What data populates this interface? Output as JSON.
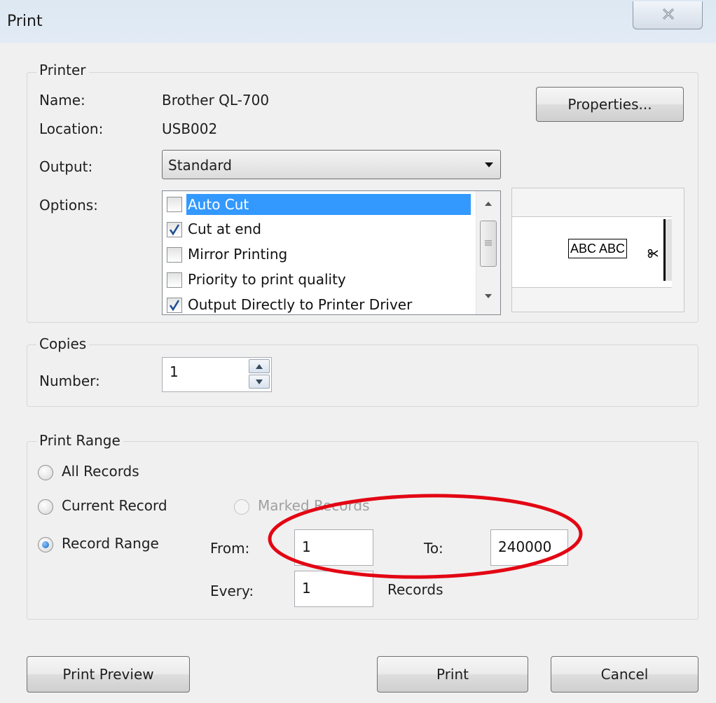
{
  "window": {
    "title": "Print"
  },
  "printer": {
    "group_label": "Printer",
    "name_label": "Name:",
    "name_value": "Brother QL-700",
    "location_label": "Location:",
    "location_value": "USB002",
    "output_label": "Output:",
    "output_value": "Standard",
    "options_label": "Options:",
    "properties_button": "Properties...",
    "options": [
      {
        "label": "Auto Cut",
        "checked": false,
        "selected": true
      },
      {
        "label": "Cut at end",
        "checked": true,
        "selected": false
      },
      {
        "label": "Mirror Printing",
        "checked": false,
        "selected": false
      },
      {
        "label": "Priority to print quality",
        "checked": false,
        "selected": false
      },
      {
        "label": "Output Directly to Printer Driver",
        "checked": true,
        "selected": false
      }
    ],
    "preview_text": "ABC ABC"
  },
  "copies": {
    "group_label": "Copies",
    "number_label": "Number:",
    "number_value": "1"
  },
  "print_range": {
    "group_label": "Print Range",
    "all_records": "All Records",
    "current_record": "Current Record",
    "marked_records": "Marked Records",
    "record_range": "Record Range",
    "selected": "record_range",
    "from_label": "From:",
    "from_value": "1",
    "to_label": "To:",
    "to_value": "240000",
    "every_label": "Every:",
    "every_value": "1",
    "records_label": "Records"
  },
  "buttons": {
    "print_preview": "Print Preview",
    "print": "Print",
    "cancel": "Cancel"
  },
  "annotation": {
    "color": "#e30613",
    "shape": "ellipse"
  }
}
